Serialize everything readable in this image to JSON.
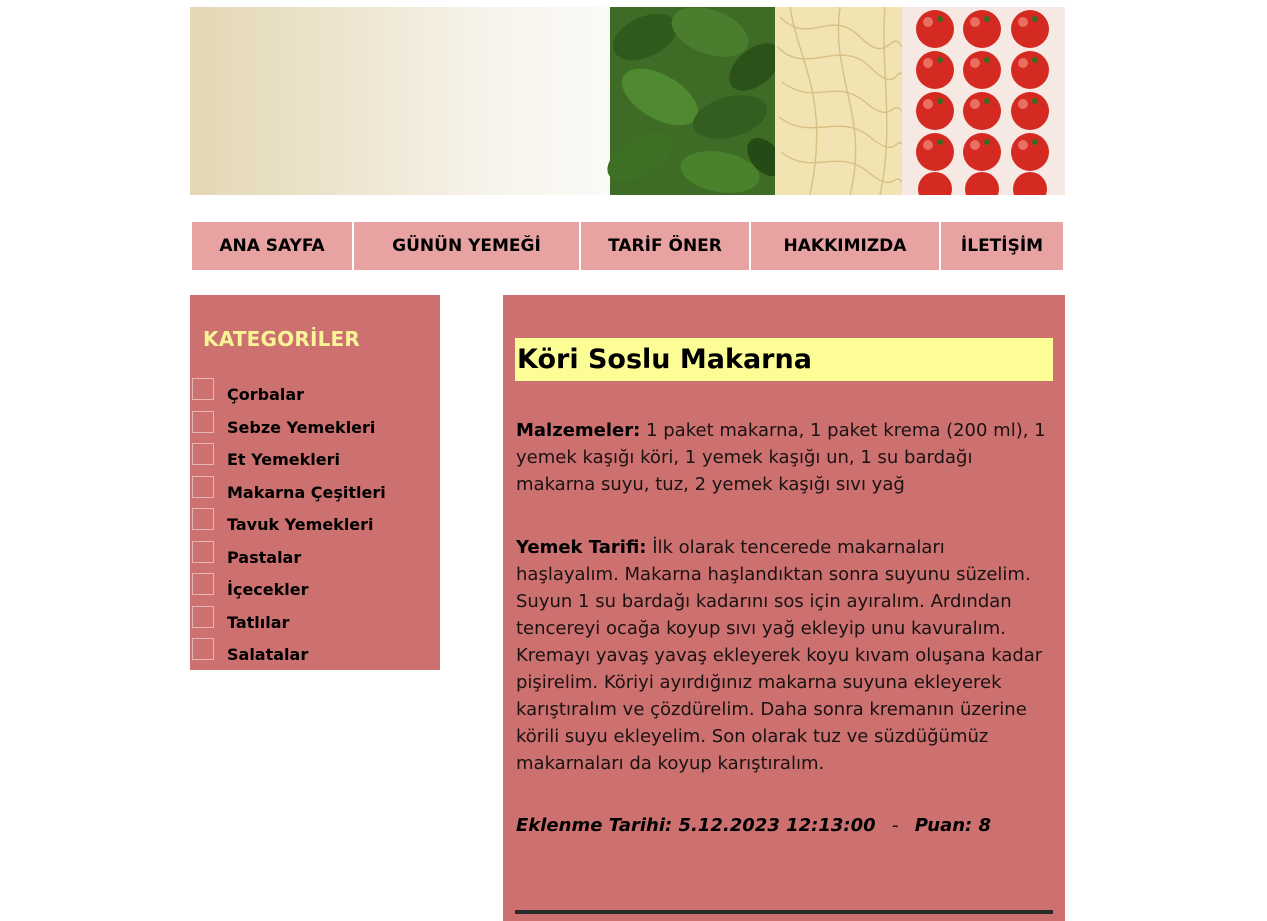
{
  "nav": {
    "items": [
      "ANA SAYFA",
      "GÜNÜN YEMEĞİ",
      "TARİF ÖNER",
      "HAKKIMIZDA",
      "İLETİŞİM"
    ]
  },
  "sidebar": {
    "title": "KATEGORİLER",
    "categories": [
      "Çorbalar",
      "Sebze Yemekleri",
      "Et Yemekleri",
      "Makarna Çeşitleri",
      "Tavuk Yemekleri",
      "Pastalar",
      "İçecekler",
      "Tatlılar",
      "Salatalar"
    ]
  },
  "recipe": {
    "title": "Köri Soslu Makarna",
    "ingredients_label": "Malzemeler:",
    "ingredients": "1 paket makarna, 1 paket krema (200 ml), 1 yemek kaşığı köri, 1 yemek kaşığı un, 1 su bardağı makarna suyu, tuz, 2 yemek kaşığı sıvı yağ",
    "instructions_label": "Yemek Tarifi:",
    "instructions": "İlk olarak tencerede makarnaları haşlayalım. Makarna haşlandıktan sonra suyunu süzelim. Suyun 1 su bardağı kadarını sos için ayıralım. Ardından tencereyi ocağa koyup sıvı yağ ekleyip unu kavuralım. Kremayı yavaş yavaş ekleyerek koyu kıvam oluşana kadar pişirelim. Köriyi ayırdığınız makarna suyuna ekleyerek karıştıralım ve çözdürelim. Daha sonra kremanın üzerine körili suyu ekleyelim. Son olarak tuz ve süzdüğümüz makarnaları da koyup karıştıralım.",
    "added_label": "Eklenme Tarihi:",
    "added_date": "5.12.2023 12:13:00",
    "separator": "-",
    "rating_label": "Puan:",
    "rating": "8"
  },
  "colors": {
    "nav_bg": "#e8a2a2",
    "panel_bg": "#cc7070",
    "title_bg": "#fdfd95",
    "sidebar_title": "#f9f597"
  }
}
